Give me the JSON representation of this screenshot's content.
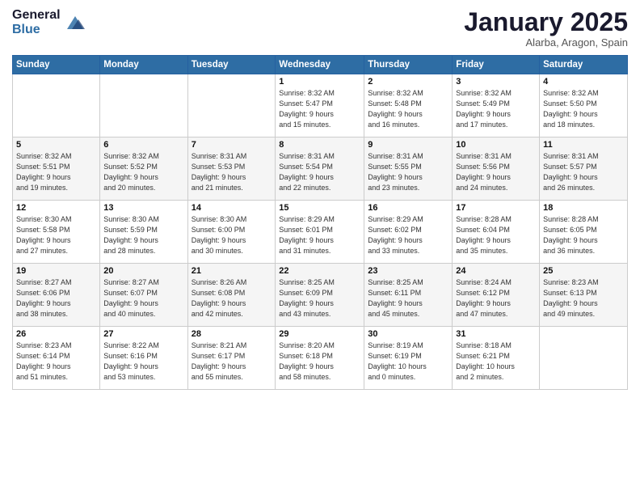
{
  "logo": {
    "general": "General",
    "blue": "Blue"
  },
  "header": {
    "month": "January 2025",
    "location": "Alarba, Aragon, Spain"
  },
  "weekdays": [
    "Sunday",
    "Monday",
    "Tuesday",
    "Wednesday",
    "Thursday",
    "Friday",
    "Saturday"
  ],
  "weeks": [
    [
      {
        "day": "",
        "info": ""
      },
      {
        "day": "",
        "info": ""
      },
      {
        "day": "",
        "info": ""
      },
      {
        "day": "1",
        "info": "Sunrise: 8:32 AM\nSunset: 5:47 PM\nDaylight: 9 hours\nand 15 minutes."
      },
      {
        "day": "2",
        "info": "Sunrise: 8:32 AM\nSunset: 5:48 PM\nDaylight: 9 hours\nand 16 minutes."
      },
      {
        "day": "3",
        "info": "Sunrise: 8:32 AM\nSunset: 5:49 PM\nDaylight: 9 hours\nand 17 minutes."
      },
      {
        "day": "4",
        "info": "Sunrise: 8:32 AM\nSunset: 5:50 PM\nDaylight: 9 hours\nand 18 minutes."
      }
    ],
    [
      {
        "day": "5",
        "info": "Sunrise: 8:32 AM\nSunset: 5:51 PM\nDaylight: 9 hours\nand 19 minutes."
      },
      {
        "day": "6",
        "info": "Sunrise: 8:32 AM\nSunset: 5:52 PM\nDaylight: 9 hours\nand 20 minutes."
      },
      {
        "day": "7",
        "info": "Sunrise: 8:31 AM\nSunset: 5:53 PM\nDaylight: 9 hours\nand 21 minutes."
      },
      {
        "day": "8",
        "info": "Sunrise: 8:31 AM\nSunset: 5:54 PM\nDaylight: 9 hours\nand 22 minutes."
      },
      {
        "day": "9",
        "info": "Sunrise: 8:31 AM\nSunset: 5:55 PM\nDaylight: 9 hours\nand 23 minutes."
      },
      {
        "day": "10",
        "info": "Sunrise: 8:31 AM\nSunset: 5:56 PM\nDaylight: 9 hours\nand 24 minutes."
      },
      {
        "day": "11",
        "info": "Sunrise: 8:31 AM\nSunset: 5:57 PM\nDaylight: 9 hours\nand 26 minutes."
      }
    ],
    [
      {
        "day": "12",
        "info": "Sunrise: 8:30 AM\nSunset: 5:58 PM\nDaylight: 9 hours\nand 27 minutes."
      },
      {
        "day": "13",
        "info": "Sunrise: 8:30 AM\nSunset: 5:59 PM\nDaylight: 9 hours\nand 28 minutes."
      },
      {
        "day": "14",
        "info": "Sunrise: 8:30 AM\nSunset: 6:00 PM\nDaylight: 9 hours\nand 30 minutes."
      },
      {
        "day": "15",
        "info": "Sunrise: 8:29 AM\nSunset: 6:01 PM\nDaylight: 9 hours\nand 31 minutes."
      },
      {
        "day": "16",
        "info": "Sunrise: 8:29 AM\nSunset: 6:02 PM\nDaylight: 9 hours\nand 33 minutes."
      },
      {
        "day": "17",
        "info": "Sunrise: 8:28 AM\nSunset: 6:04 PM\nDaylight: 9 hours\nand 35 minutes."
      },
      {
        "day": "18",
        "info": "Sunrise: 8:28 AM\nSunset: 6:05 PM\nDaylight: 9 hours\nand 36 minutes."
      }
    ],
    [
      {
        "day": "19",
        "info": "Sunrise: 8:27 AM\nSunset: 6:06 PM\nDaylight: 9 hours\nand 38 minutes."
      },
      {
        "day": "20",
        "info": "Sunrise: 8:27 AM\nSunset: 6:07 PM\nDaylight: 9 hours\nand 40 minutes."
      },
      {
        "day": "21",
        "info": "Sunrise: 8:26 AM\nSunset: 6:08 PM\nDaylight: 9 hours\nand 42 minutes."
      },
      {
        "day": "22",
        "info": "Sunrise: 8:25 AM\nSunset: 6:09 PM\nDaylight: 9 hours\nand 43 minutes."
      },
      {
        "day": "23",
        "info": "Sunrise: 8:25 AM\nSunset: 6:11 PM\nDaylight: 9 hours\nand 45 minutes."
      },
      {
        "day": "24",
        "info": "Sunrise: 8:24 AM\nSunset: 6:12 PM\nDaylight: 9 hours\nand 47 minutes."
      },
      {
        "day": "25",
        "info": "Sunrise: 8:23 AM\nSunset: 6:13 PM\nDaylight: 9 hours\nand 49 minutes."
      }
    ],
    [
      {
        "day": "26",
        "info": "Sunrise: 8:23 AM\nSunset: 6:14 PM\nDaylight: 9 hours\nand 51 minutes."
      },
      {
        "day": "27",
        "info": "Sunrise: 8:22 AM\nSunset: 6:16 PM\nDaylight: 9 hours\nand 53 minutes."
      },
      {
        "day": "28",
        "info": "Sunrise: 8:21 AM\nSunset: 6:17 PM\nDaylight: 9 hours\nand 55 minutes."
      },
      {
        "day": "29",
        "info": "Sunrise: 8:20 AM\nSunset: 6:18 PM\nDaylight: 9 hours\nand 58 minutes."
      },
      {
        "day": "30",
        "info": "Sunrise: 8:19 AM\nSunset: 6:19 PM\nDaylight: 10 hours\nand 0 minutes."
      },
      {
        "day": "31",
        "info": "Sunrise: 8:18 AM\nSunset: 6:21 PM\nDaylight: 10 hours\nand 2 minutes."
      },
      {
        "day": "",
        "info": ""
      }
    ]
  ]
}
